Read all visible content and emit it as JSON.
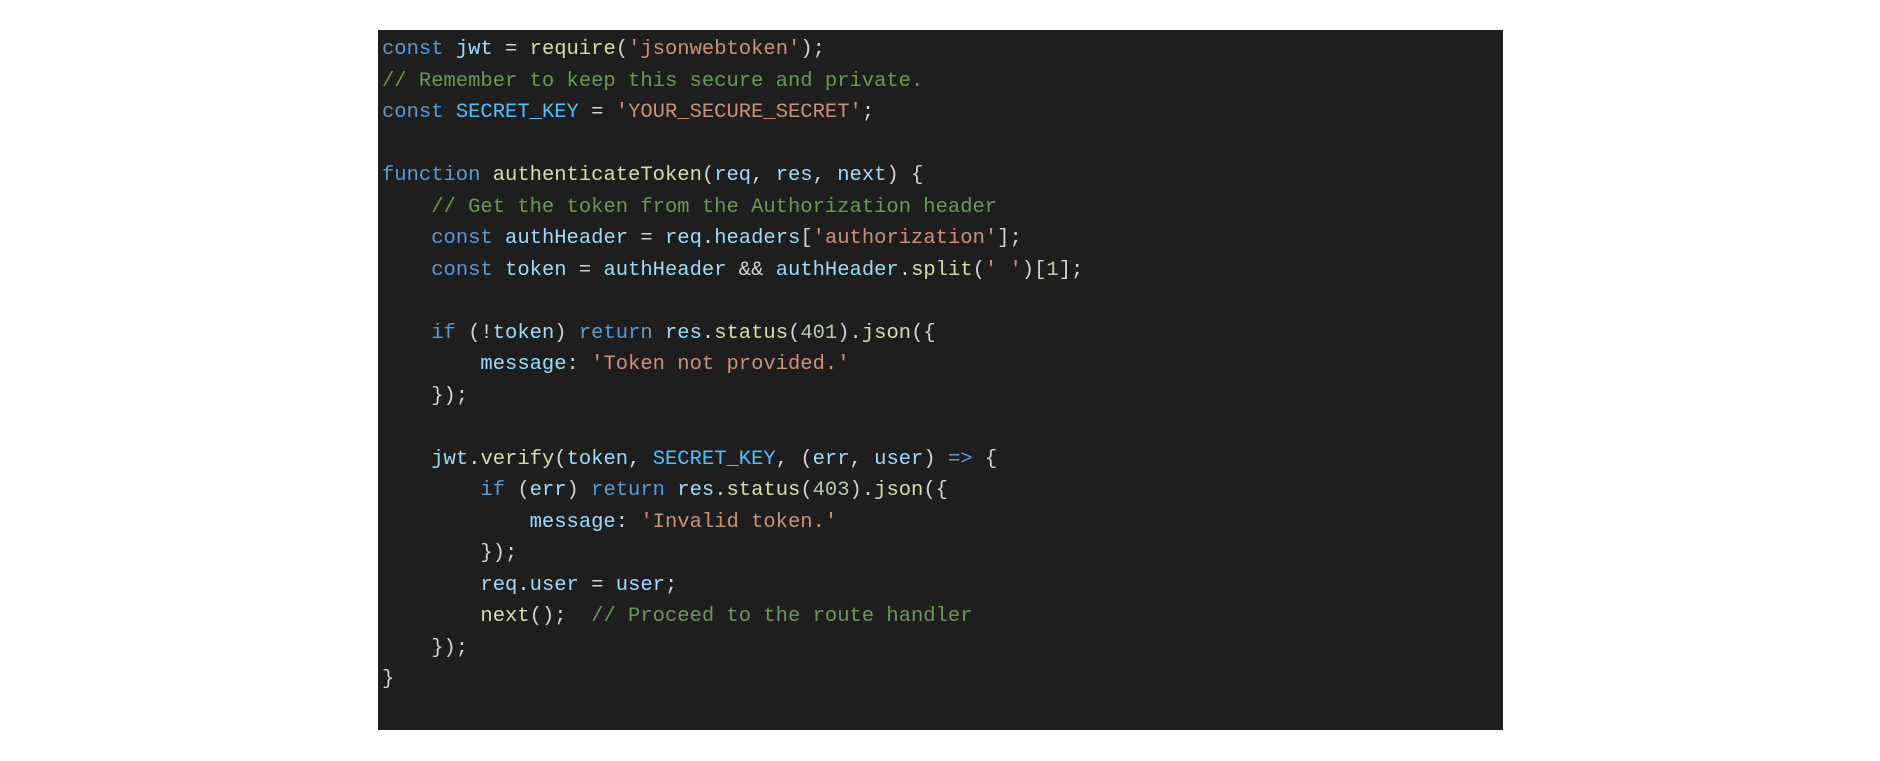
{
  "code": {
    "language": "javascript",
    "lines": [
      [
        {
          "c": "tok-kw",
          "t": "const"
        },
        {
          "c": "tok-punct",
          "t": " "
        },
        {
          "c": "tok-var",
          "t": "jwt"
        },
        {
          "c": "tok-punct",
          "t": " = "
        },
        {
          "c": "tok-fn",
          "t": "require"
        },
        {
          "c": "tok-punct",
          "t": "("
        },
        {
          "c": "tok-str",
          "t": "'jsonwebtoken'"
        },
        {
          "c": "tok-punct",
          "t": ");"
        }
      ],
      [
        {
          "c": "tok-cmt",
          "t": "// Remember to keep this secure and private."
        }
      ],
      [
        {
          "c": "tok-kw",
          "t": "const"
        },
        {
          "c": "tok-punct",
          "t": " "
        },
        {
          "c": "tok-const",
          "t": "SECRET_KEY"
        },
        {
          "c": "tok-punct",
          "t": " = "
        },
        {
          "c": "tok-str",
          "t": "'YOUR_SECURE_SECRET'"
        },
        {
          "c": "tok-punct",
          "t": ";"
        }
      ],
      [
        {
          "c": "tok-punct",
          "t": ""
        }
      ],
      [
        {
          "c": "tok-kw",
          "t": "function"
        },
        {
          "c": "tok-punct",
          "t": " "
        },
        {
          "c": "tok-fn",
          "t": "authenticateToken"
        },
        {
          "c": "tok-punct",
          "t": "("
        },
        {
          "c": "tok-var",
          "t": "req"
        },
        {
          "c": "tok-punct",
          "t": ", "
        },
        {
          "c": "tok-var",
          "t": "res"
        },
        {
          "c": "tok-punct",
          "t": ", "
        },
        {
          "c": "tok-var",
          "t": "next"
        },
        {
          "c": "tok-punct",
          "t": ") {"
        }
      ],
      [
        {
          "c": "tok-punct",
          "t": "    "
        },
        {
          "c": "tok-cmt",
          "t": "// Get the token from the Authorization header"
        }
      ],
      [
        {
          "c": "tok-punct",
          "t": "    "
        },
        {
          "c": "tok-kw",
          "t": "const"
        },
        {
          "c": "tok-punct",
          "t": " "
        },
        {
          "c": "tok-var",
          "t": "authHeader"
        },
        {
          "c": "tok-punct",
          "t": " = "
        },
        {
          "c": "tok-var",
          "t": "req"
        },
        {
          "c": "tok-punct",
          "t": "."
        },
        {
          "c": "tok-var",
          "t": "headers"
        },
        {
          "c": "tok-punct",
          "t": "["
        },
        {
          "c": "tok-str",
          "t": "'authorization'"
        },
        {
          "c": "tok-punct",
          "t": "];"
        }
      ],
      [
        {
          "c": "tok-punct",
          "t": "    "
        },
        {
          "c": "tok-kw",
          "t": "const"
        },
        {
          "c": "tok-punct",
          "t": " "
        },
        {
          "c": "tok-var",
          "t": "token"
        },
        {
          "c": "tok-punct",
          "t": " = "
        },
        {
          "c": "tok-var",
          "t": "authHeader"
        },
        {
          "c": "tok-punct",
          "t": " && "
        },
        {
          "c": "tok-var",
          "t": "authHeader"
        },
        {
          "c": "tok-punct",
          "t": "."
        },
        {
          "c": "tok-fn",
          "t": "split"
        },
        {
          "c": "tok-punct",
          "t": "("
        },
        {
          "c": "tok-str",
          "t": "' '"
        },
        {
          "c": "tok-punct",
          "t": ")["
        },
        {
          "c": "tok-num",
          "t": "1"
        },
        {
          "c": "tok-punct",
          "t": "];"
        }
      ],
      [
        {
          "c": "tok-punct",
          "t": ""
        }
      ],
      [
        {
          "c": "tok-punct",
          "t": "    "
        },
        {
          "c": "tok-kw",
          "t": "if"
        },
        {
          "c": "tok-punct",
          "t": " (!"
        },
        {
          "c": "tok-var",
          "t": "token"
        },
        {
          "c": "tok-punct",
          "t": ") "
        },
        {
          "c": "tok-kw",
          "t": "return"
        },
        {
          "c": "tok-punct",
          "t": " "
        },
        {
          "c": "tok-var",
          "t": "res"
        },
        {
          "c": "tok-punct",
          "t": "."
        },
        {
          "c": "tok-fn",
          "t": "status"
        },
        {
          "c": "tok-punct",
          "t": "("
        },
        {
          "c": "tok-num",
          "t": "401"
        },
        {
          "c": "tok-punct",
          "t": ")."
        },
        {
          "c": "tok-fn",
          "t": "json"
        },
        {
          "c": "tok-punct",
          "t": "({"
        }
      ],
      [
        {
          "c": "tok-punct",
          "t": "        "
        },
        {
          "c": "tok-var",
          "t": "message"
        },
        {
          "c": "tok-punct",
          "t": ": "
        },
        {
          "c": "tok-str",
          "t": "'Token not provided.'"
        }
      ],
      [
        {
          "c": "tok-punct",
          "t": "    });"
        }
      ],
      [
        {
          "c": "tok-punct",
          "t": ""
        }
      ],
      [
        {
          "c": "tok-punct",
          "t": "    "
        },
        {
          "c": "tok-var",
          "t": "jwt"
        },
        {
          "c": "tok-punct",
          "t": "."
        },
        {
          "c": "tok-fn",
          "t": "verify"
        },
        {
          "c": "tok-punct",
          "t": "("
        },
        {
          "c": "tok-var",
          "t": "token"
        },
        {
          "c": "tok-punct",
          "t": ", "
        },
        {
          "c": "tok-const",
          "t": "SECRET_KEY"
        },
        {
          "c": "tok-punct",
          "t": ", ("
        },
        {
          "c": "tok-var",
          "t": "err"
        },
        {
          "c": "tok-punct",
          "t": ", "
        },
        {
          "c": "tok-var",
          "t": "user"
        },
        {
          "c": "tok-punct",
          "t": ") "
        },
        {
          "c": "tok-kw",
          "t": "=>"
        },
        {
          "c": "tok-punct",
          "t": " {"
        }
      ],
      [
        {
          "c": "tok-punct",
          "t": "        "
        },
        {
          "c": "tok-kw",
          "t": "if"
        },
        {
          "c": "tok-punct",
          "t": " ("
        },
        {
          "c": "tok-var",
          "t": "err"
        },
        {
          "c": "tok-punct",
          "t": ") "
        },
        {
          "c": "tok-kw",
          "t": "return"
        },
        {
          "c": "tok-punct",
          "t": " "
        },
        {
          "c": "tok-var",
          "t": "res"
        },
        {
          "c": "tok-punct",
          "t": "."
        },
        {
          "c": "tok-fn",
          "t": "status"
        },
        {
          "c": "tok-punct",
          "t": "("
        },
        {
          "c": "tok-num",
          "t": "403"
        },
        {
          "c": "tok-punct",
          "t": ")."
        },
        {
          "c": "tok-fn",
          "t": "json"
        },
        {
          "c": "tok-punct",
          "t": "({"
        }
      ],
      [
        {
          "c": "tok-punct",
          "t": "            "
        },
        {
          "c": "tok-var",
          "t": "message"
        },
        {
          "c": "tok-punct",
          "t": ": "
        },
        {
          "c": "tok-str",
          "t": "'Invalid token.'"
        }
      ],
      [
        {
          "c": "tok-punct",
          "t": "        });"
        }
      ],
      [
        {
          "c": "tok-punct",
          "t": "        "
        },
        {
          "c": "tok-var",
          "t": "req"
        },
        {
          "c": "tok-punct",
          "t": "."
        },
        {
          "c": "tok-var",
          "t": "user"
        },
        {
          "c": "tok-punct",
          "t": " = "
        },
        {
          "c": "tok-var",
          "t": "user"
        },
        {
          "c": "tok-punct",
          "t": ";"
        }
      ],
      [
        {
          "c": "tok-punct",
          "t": "        "
        },
        {
          "c": "tok-fn",
          "t": "next"
        },
        {
          "c": "tok-punct",
          "t": "();  "
        },
        {
          "c": "tok-cmt",
          "t": "// Proceed to the route handler"
        }
      ],
      [
        {
          "c": "tok-punct",
          "t": "    });"
        }
      ],
      [
        {
          "c": "tok-punct",
          "t": "}"
        }
      ]
    ]
  }
}
